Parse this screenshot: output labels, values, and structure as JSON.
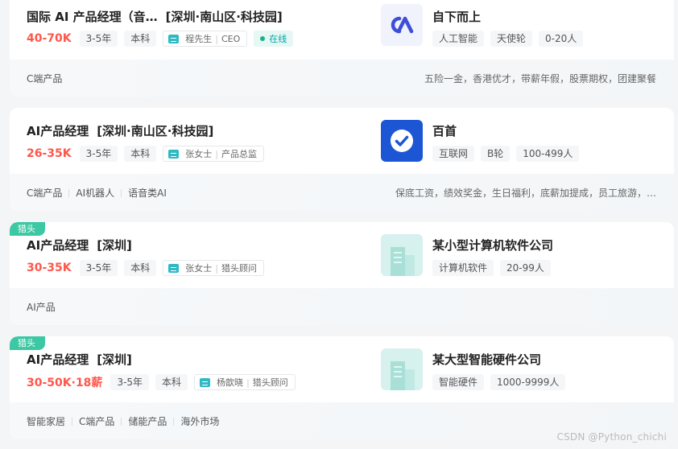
{
  "jobs": [
    {
      "title": "国际 AI 产品经理（音…",
      "location": "[深圳·南山区·科技园]",
      "salary": "40-70K",
      "experience": "3-5年",
      "degree": "本科",
      "recruiter_name": "程先生",
      "recruiter_role": "CEO",
      "online": "在线",
      "company": "自下而上",
      "company_tags": [
        "人工智能",
        "天使轮",
        "0-20人"
      ],
      "skills": [
        "C端产品"
      ],
      "welfare": "五险一金，香港优才，带薪年假，股票期权，团建聚餐"
    },
    {
      "title": "AI产品经理",
      "location": "[深圳·南山区·科技园]",
      "salary": "26-35K",
      "experience": "3-5年",
      "degree": "本科",
      "recruiter_name": "张女士",
      "recruiter_role": "产品总监",
      "company": "百首",
      "company_tags": [
        "互联网",
        "B轮",
        "100-499人"
      ],
      "skills": [
        "C端产品",
        "AI机器人",
        "语音类AI"
      ],
      "welfare": "保底工资，绩效奖金，生日福利，底薪加提成，员工旅游，…"
    },
    {
      "badge": "猎头",
      "title": "AI产品经理",
      "location": "[深圳]",
      "salary": "30-35K",
      "experience": "3-5年",
      "degree": "本科",
      "recruiter_name": "张女士",
      "recruiter_role": "猎头顾问",
      "company": "某小型计算机软件公司",
      "company_tags": [
        "计算机软件",
        "20-99人"
      ],
      "skills": [
        "AI产品"
      ],
      "welfare": ""
    },
    {
      "badge": "猎头",
      "title": "AI产品经理",
      "location": "[深圳]",
      "salary": "30-50K·18薪",
      "experience": "3-5年",
      "degree": "本科",
      "recruiter_name": "杨歆晓",
      "recruiter_role": "猎头顾问",
      "company": "某大型智能硬件公司",
      "company_tags": [
        "智能硬件",
        "1000-9999人"
      ],
      "skills": [
        "智能家居",
        "C端产品",
        "储能产品",
        "海外市场"
      ],
      "welfare": ""
    }
  ],
  "watermark": "CSDN @Python_chichi",
  "colors": {
    "salary": "#fe574a",
    "online": "#00a6a7",
    "hunter_badge": "#3cc8a3",
    "brand_blue": "#1d56d5"
  }
}
